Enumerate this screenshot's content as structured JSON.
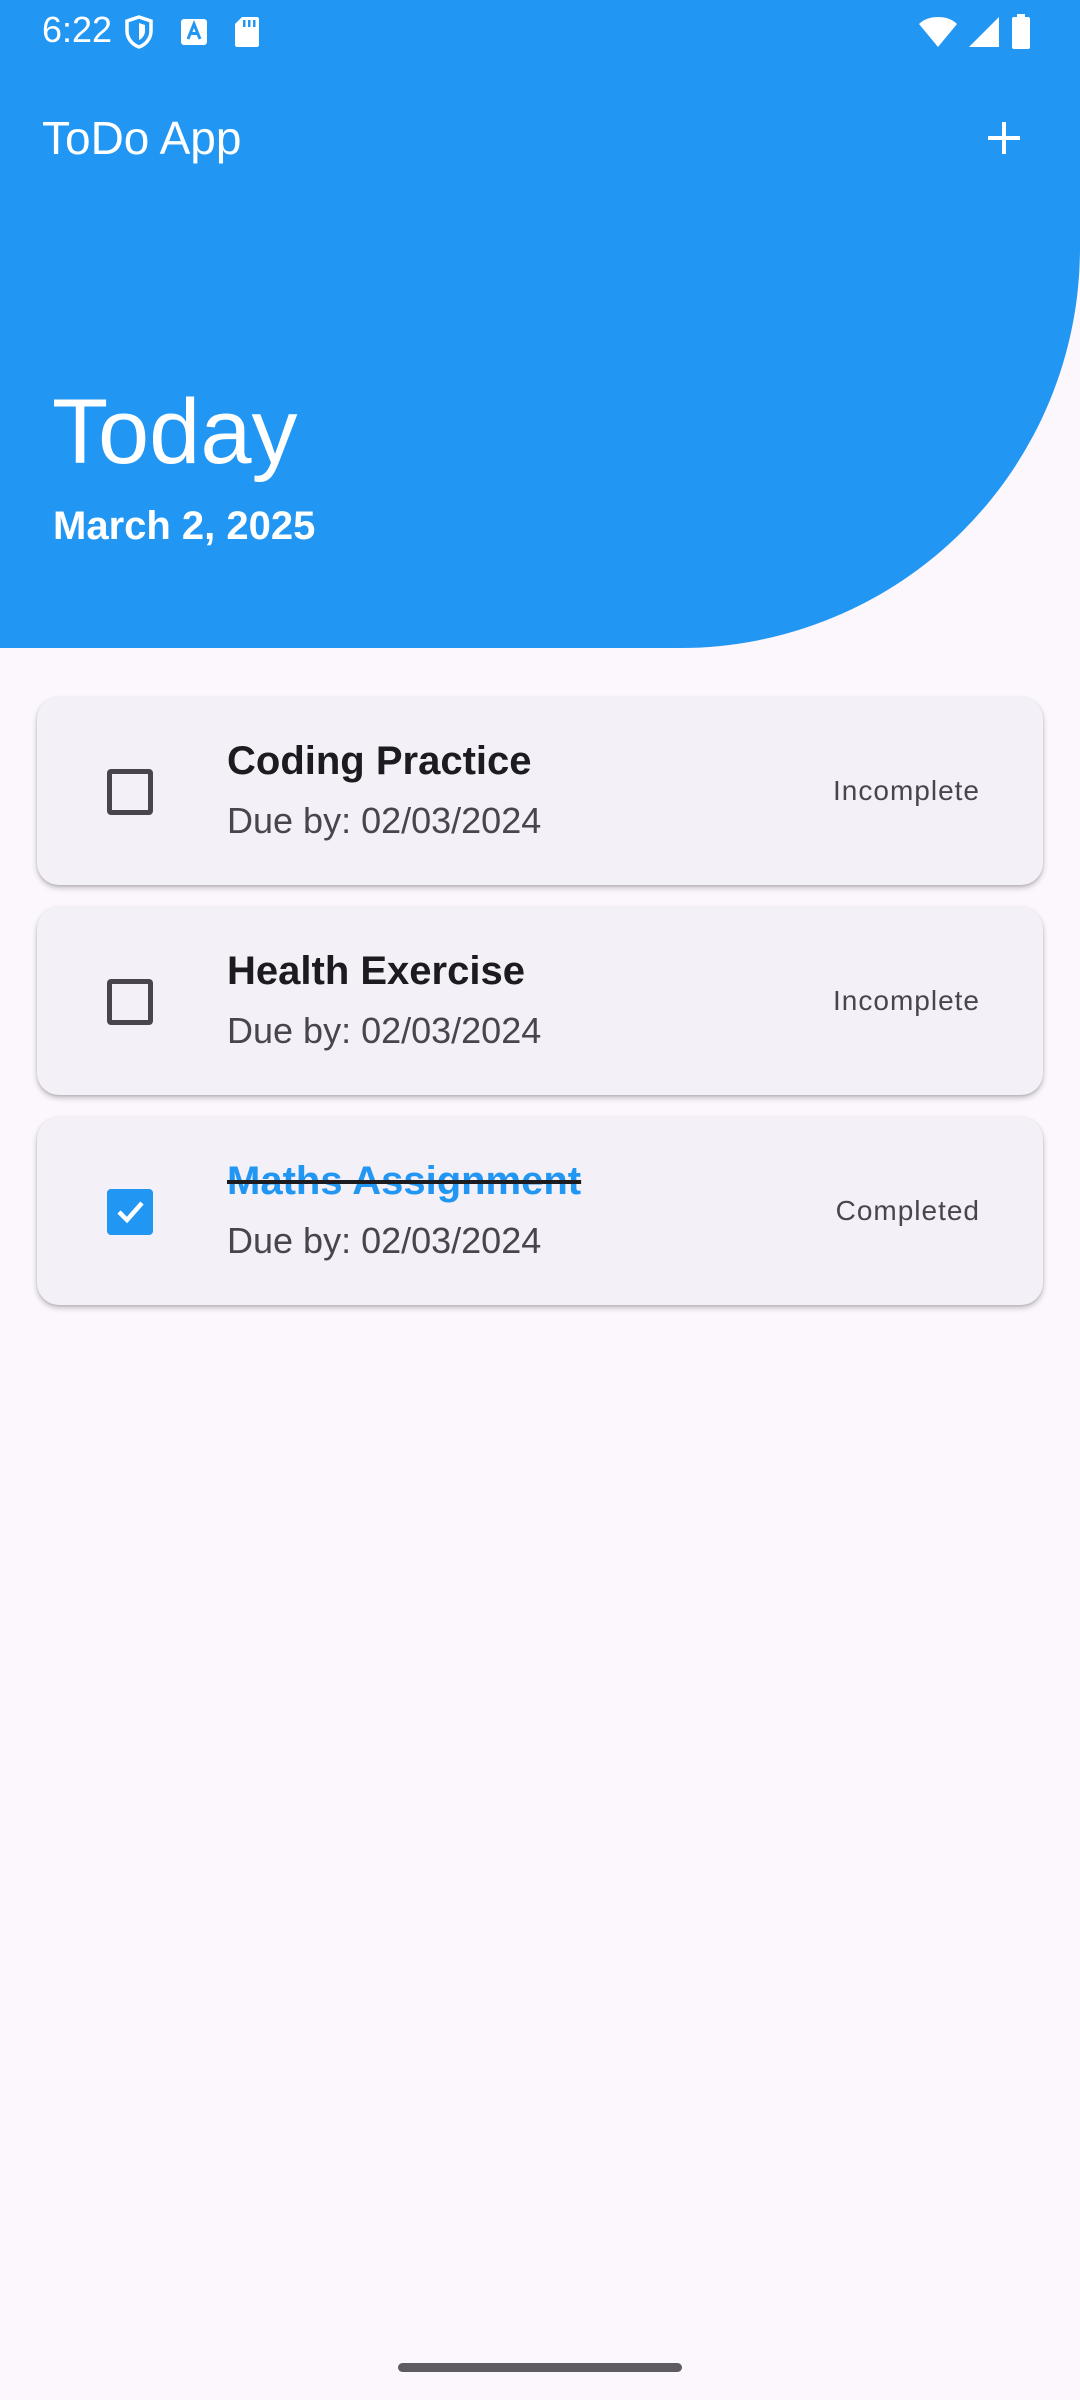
{
  "status_bar": {
    "time": "6:22",
    "left_icons": [
      "shield-icon",
      "text-a-icon",
      "sd-card-icon"
    ],
    "right_icons": [
      "wifi-icon",
      "cell-signal-icon",
      "battery-icon"
    ]
  },
  "app_bar": {
    "title": "ToDo App",
    "action_icon": "plus-icon"
  },
  "header": {
    "title": "Today",
    "date": "March 2, 2025"
  },
  "tasks": [
    {
      "title": "Coding Practice",
      "due": "Due by: 02/03/2024",
      "status": "Incomplete",
      "checked": false
    },
    {
      "title": "Health Exercise",
      "due": "Due by: 02/03/2024",
      "status": "Incomplete",
      "checked": false
    },
    {
      "title": "Maths Assignment",
      "due": "Due by: 02/03/2024",
      "status": "Completed",
      "checked": true
    }
  ],
  "colors": {
    "primary": "#2196f3",
    "background": "#fcf6fd",
    "card": "#f4f0f7",
    "text": "#1c1b1f",
    "secondary_text": "#49454f"
  }
}
